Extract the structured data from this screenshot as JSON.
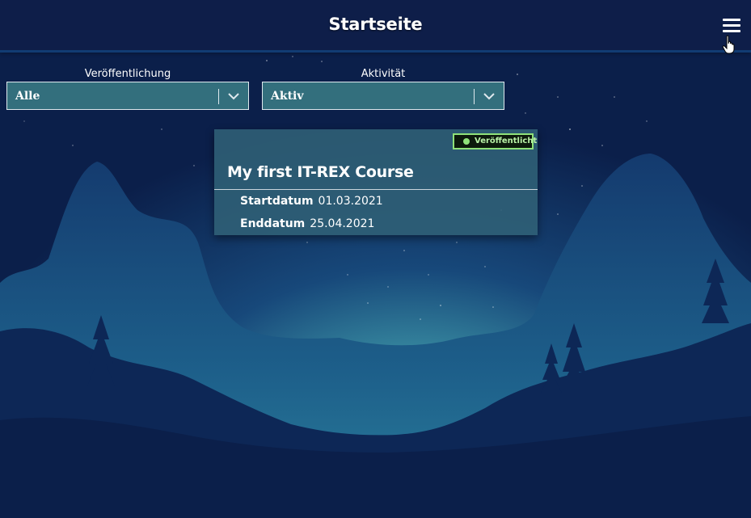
{
  "header": {
    "title": "Startseite"
  },
  "icons": {
    "menu": "hamburger-menu-icon",
    "cursor": "hand-pointer-icon",
    "chevron": "chevron-down-icon",
    "status_dot": "status-dot-icon"
  },
  "filters": {
    "publication": {
      "label": "Veröffentlichung",
      "selected": "Alle"
    },
    "activity": {
      "label": "Aktivität",
      "selected": "Aktiv"
    }
  },
  "courses": [
    {
      "status": "Veröffentlicht",
      "title": "My first IT-REX Course",
      "start_label": "Startdatum",
      "start_date": "01.03.2021",
      "end_label": "Enddatum",
      "end_date": "25.04.2021"
    }
  ],
  "colors": {
    "header_bg": "#0e1e49",
    "select_bg": "#3f868c",
    "card_bg": "#306176",
    "badge_border": "#8fe27a",
    "sky_top": "#0b1f4a",
    "glow": "#7ecfd3"
  }
}
